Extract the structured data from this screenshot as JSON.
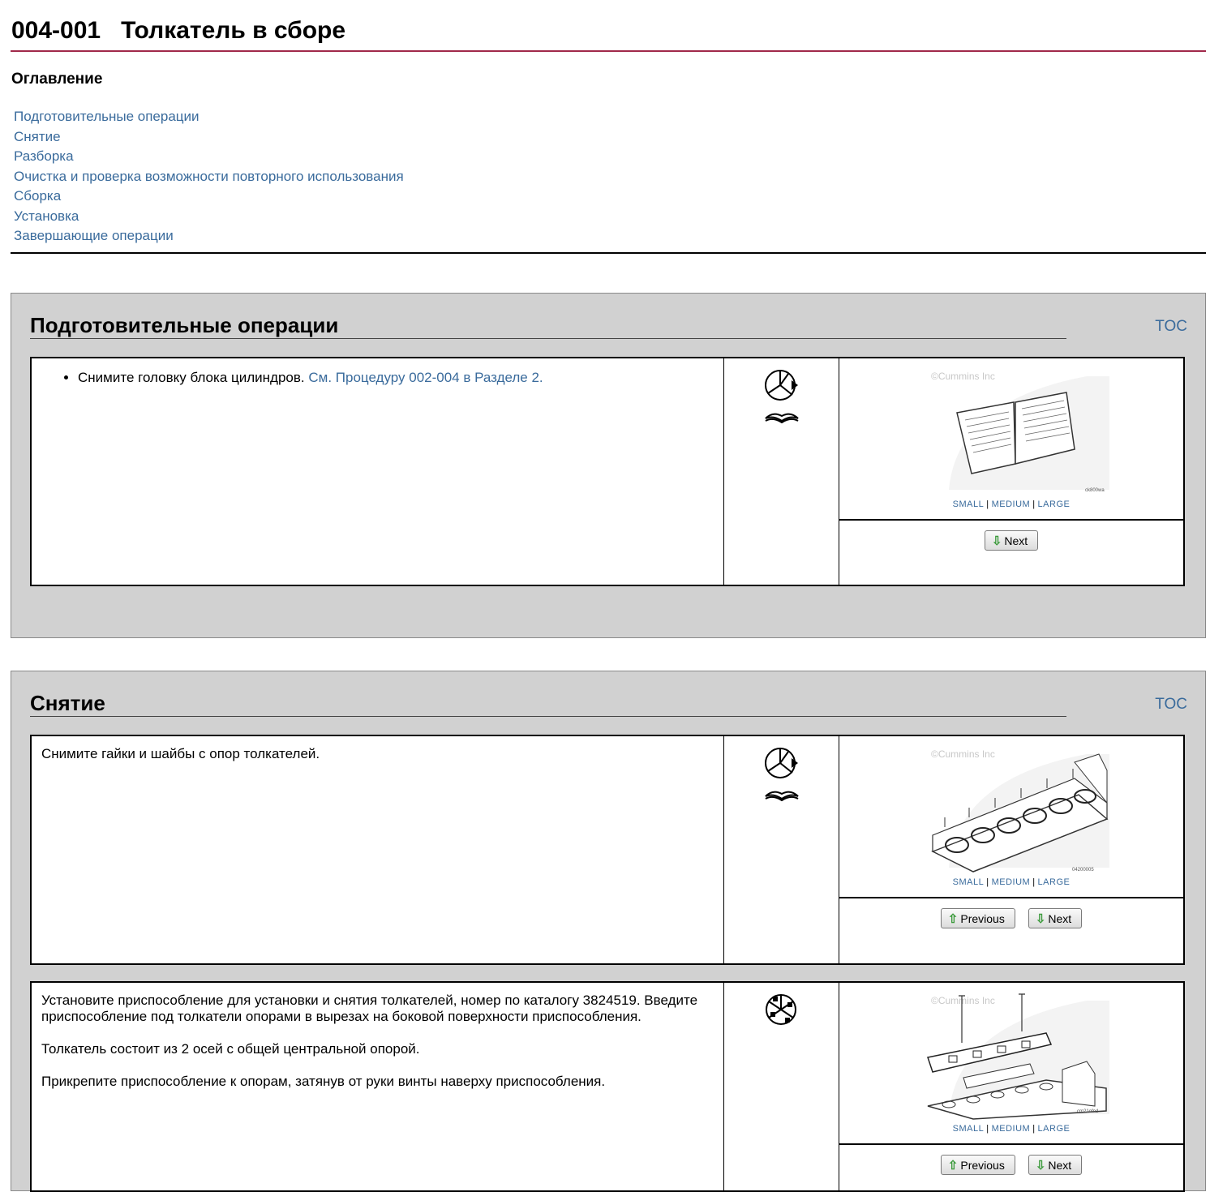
{
  "page": {
    "number": "004-001",
    "title": "Толкатель в сборе"
  },
  "toc": {
    "heading": "Оглавление",
    "items": [
      "Подготовительные операции",
      "Снятие",
      "Разборка",
      "Очистка и проверка возможности повторного использования",
      "Сборка",
      "Установка",
      "Завершающие операции"
    ]
  },
  "sections": [
    {
      "title": "Подготовительные операции",
      "toc_link": "TOC",
      "steps": [
        {
          "bullet_text": "Снимите головку блока цилиндров.",
          "link_text": "См. Процедуру 002-004 в Разделе 2.",
          "icons": [
            "wrench-clock-icon",
            "manual-book-icon"
          ],
          "image": {
            "copyright": "©Cummins Inc",
            "code": "ck800wa",
            "subject": "manual"
          },
          "size_links": [
            "SMALL",
            "MEDIUM",
            "LARGE"
          ],
          "buttons": [
            "Next"
          ]
        }
      ]
    },
    {
      "title": "Снятие",
      "toc_link": "TOC",
      "steps": [
        {
          "paragraphs": [
            "Снимите гайки и шайбы с опор толкателей."
          ],
          "icons": [
            "wrench-clock-icon",
            "manual-book-icon"
          ],
          "image": {
            "copyright": "©Cummins Inc",
            "code": "04200005",
            "subject": "engine-head"
          },
          "size_links": [
            "SMALL",
            "MEDIUM",
            "LARGE"
          ],
          "buttons": [
            "Previous",
            "Next"
          ]
        },
        {
          "paragraphs": [
            "Установите приспособление для установки и снятия толкателей, номер по каталогу 3824519. Введите приспособление под толкатели опорами в вырезах на боковой поверхности приспособления.",
            "Толкатель состоит из 2 осей с общей центральной опорой.",
            "Прикрепите приспособление к опорам, затянув от руки винты наверху приспособления."
          ],
          "icons": [
            "special-tool-icon"
          ],
          "image": {
            "copyright": "©Cummins Inc",
            "code": "cm21ofnd",
            "subject": "tool-install"
          },
          "size_links": [
            "SMALL",
            "MEDIUM",
            "LARGE"
          ],
          "buttons": [
            "Previous",
            "Next"
          ]
        }
      ]
    }
  ]
}
